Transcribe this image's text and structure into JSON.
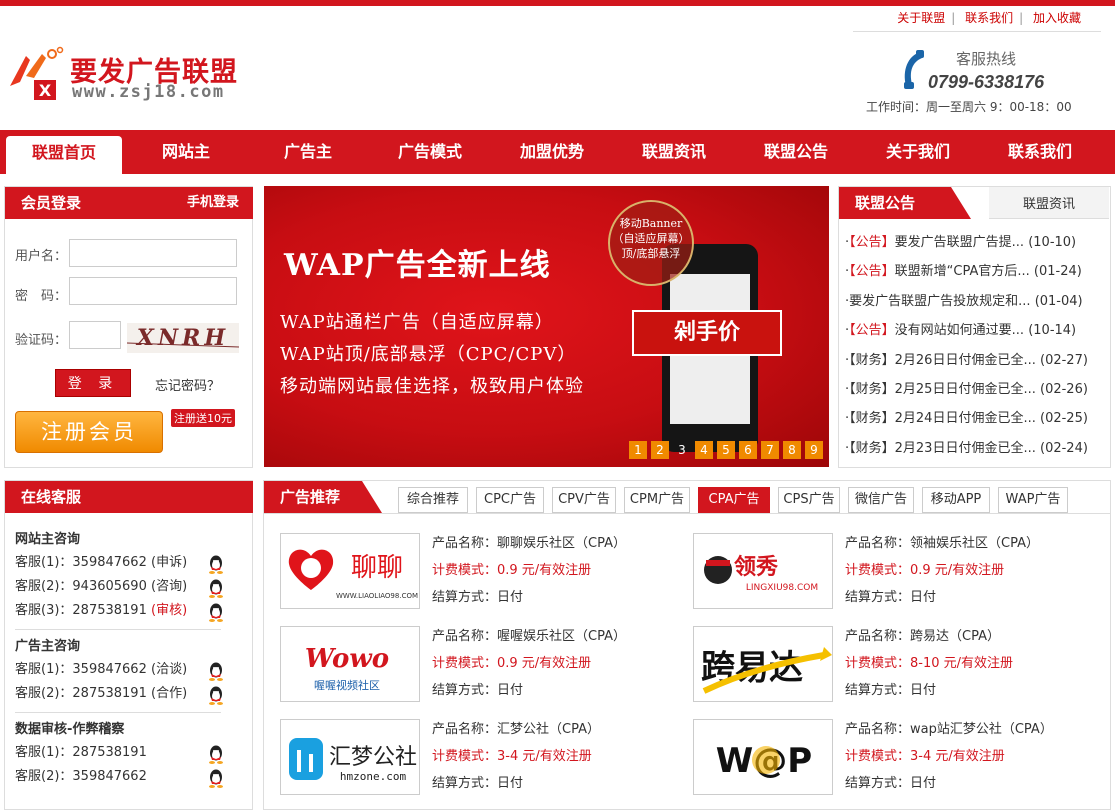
{
  "toplinks": [
    "关于联盟",
    "联系我们",
    "加入收藏"
  ],
  "brand": {
    "name": "要发广告联盟",
    "url": "www.zsj18.com"
  },
  "hotline": {
    "label": "客服热线",
    "phone": "0799-6338176",
    "hours": "工作时间：周一至周六 9：00-18：00"
  },
  "nav": [
    "联盟首页",
    "网站主",
    "广告主",
    "广告模式",
    "加盟优势",
    "联盟资讯",
    "联盟公告",
    "关于我们",
    "联系我们"
  ],
  "login": {
    "title": "会员登录",
    "mobile": "手机登录",
    "username_label": "用户名：",
    "password_label": "密　码：",
    "captcha_label": "验证码：",
    "captcha_text": "XNRH",
    "login_btn": "登 录",
    "forgot": "忘记密码？",
    "register_btn": "注册会员",
    "register_badge": "注册送10元"
  },
  "banner": {
    "headline": "WAP广告全新上线",
    "lines": [
      "WAP站通栏广告（自适应屏幕）",
      "WAP站顶/底部悬浮（CPC/CPV）",
      "移动端网站最佳选择，极致用户体验"
    ],
    "stamp": [
      "移动Banner",
      "（自适应屏幕）",
      "顶/底部悬浮"
    ],
    "promo": "剁手价",
    "pages": [
      "1",
      "2",
      "3",
      "4",
      "5",
      "6",
      "7",
      "8",
      "9"
    ],
    "current_page": "3"
  },
  "notices": {
    "tab_active": "联盟公告",
    "tab_other": "联盟资讯",
    "items": [
      {
        "bullet": "·",
        "tag": "【公告】",
        "text": "要发广告联盟广告提...",
        "date": "(10-10)"
      },
      {
        "bullet": "·",
        "tag": "【公告】",
        "text": "联盟新增“CPA官方后...",
        "date": "(01-24)"
      },
      {
        "bullet": "·",
        "tag": "",
        "text": "要发广告联盟广告投放规定和...",
        "date": "(01-04)"
      },
      {
        "bullet": "·",
        "tag": "【公告】",
        "text": "没有网站如何通过要...",
        "date": "(10-14)"
      },
      {
        "bullet": "·",
        "tag": "",
        "text": "【财务】2月26日日付佣金已全...",
        "date": "(02-27)"
      },
      {
        "bullet": "·",
        "tag": "",
        "text": "【财务】2月25日日付佣金已全...",
        "date": "(02-26)"
      },
      {
        "bullet": "·",
        "tag": "",
        "text": "【财务】2月24日日付佣金已全...",
        "date": "(02-25)"
      },
      {
        "bullet": "·",
        "tag": "",
        "text": "【财务】2月23日日付佣金已全...",
        "date": "(02-24)"
      }
    ]
  },
  "support": {
    "title": "在线客服",
    "groups": [
      {
        "title": "网站主咨询",
        "rows": [
          {
            "label": "客服(1)：359847662",
            "note": "(申诉)",
            "note_red": false
          },
          {
            "label": "客服(2)：943605690",
            "note": "(咨询)",
            "note_red": false
          },
          {
            "label": "客服(3)：287538191",
            "note": "(审核)",
            "note_red": true
          }
        ]
      },
      {
        "title": "广告主咨询",
        "rows": [
          {
            "label": "客服(1)：359847662",
            "note": "(洽谈)",
            "note_red": false
          },
          {
            "label": "客服(2)：287538191",
            "note": "(合作)",
            "note_red": false
          }
        ]
      },
      {
        "title": "数据审核-作弊稽察",
        "rows": [
          {
            "label": "客服(1)：287538191",
            "note": "",
            "note_red": false
          },
          {
            "label": "客服(2)：359847662",
            "note": "",
            "note_red": false
          }
        ]
      }
    ]
  },
  "ads": {
    "title": "广告推荐",
    "tabs": [
      "综合推荐",
      "CPC广告",
      "CPV广告",
      "CPM广告",
      "CPA广告",
      "CPS广告",
      "微信广告",
      "移动APP",
      "WAP广告"
    ],
    "active_tab": "CPA广告",
    "products": [
      {
        "name": "产品名称：聊聊娱乐社区（CPA）",
        "fee": "计费模式：0.9 元/有效注册",
        "settle": "结算方式：日付",
        "logo": "聊聊",
        "logo_sub": "WWW.LIAOLIAO98.COM"
      },
      {
        "name": "产品名称：领袖娱乐社区（CPA）",
        "fee": "计费模式：0.9 元/有效注册",
        "settle": "结算方式：日付",
        "logo": "领秀",
        "logo_sub": "LINGXIU98.COM"
      },
      {
        "name": "产品名称：喔喔娱乐社区（CPA）",
        "fee": "计费模式：0.9 元/有效注册",
        "settle": "结算方式：日付",
        "logo": "Wowo",
        "logo_sub": "喔喔视频社区"
      },
      {
        "name": "产品名称：跨易达（CPA）",
        "fee": "计费模式：8-10 元/有效注册",
        "settle": "结算方式：日付",
        "logo": "跨易达",
        "logo_sub": ""
      },
      {
        "name": "产品名称：汇梦公社（CPA）",
        "fee": "计费模式：3-4 元/有效注册",
        "settle": "结算方式：日付",
        "logo": "汇梦公社",
        "logo_sub": "hmzone.com"
      },
      {
        "name": "产品名称：wap站汇梦公社（CPA）",
        "fee": "计费模式：3-4 元/有效注册",
        "settle": "结算方式：日付",
        "logo": "W@P",
        "logo_sub": ""
      }
    ]
  },
  "colors": {
    "brand_red": "#d2161e",
    "orange": "#f08a00"
  }
}
